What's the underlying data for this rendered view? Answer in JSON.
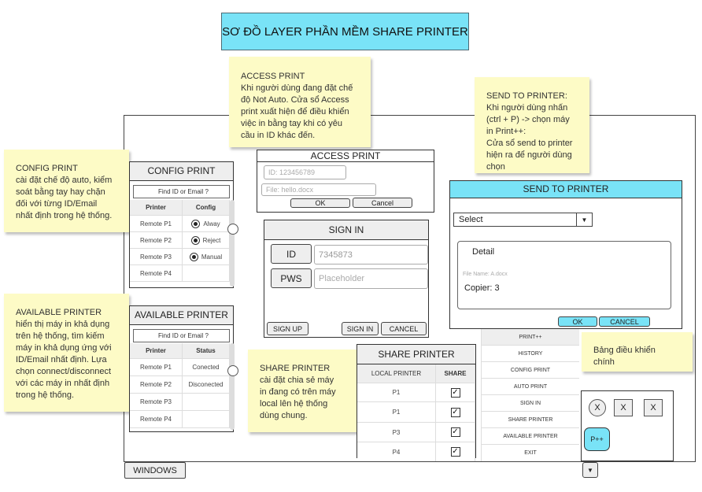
{
  "title": "SƠ ĐỒ LAYER PHẦN MỀM SHARE PRINTER",
  "notes": {
    "access": {
      "title": "ACCESS PRINT",
      "body": "Khi người dùng đang đặt chế\nđộ Not Auto. Cửa sổ Access\nprint xuất hiện để điều khiển\nviệc in bằng tay khi có yêu\ncầu in ID khác đến."
    },
    "send": {
      "title": "SEND TO PRINTER:",
      "body": "Khi người dùng nhấn\n(ctrl + P) -> chọn máy\nin Print++:\nCửa sổ send to printer\nhiện ra để người dùng\nchọn"
    },
    "config": {
      "title": "CONFIG PRINT",
      "body": "cài đặt chế độ auto, kiểm\nsoát bằng tay hay chặn\nđối với từng ID/Email\nnhất định trong hệ thống."
    },
    "available": {
      "title": "AVAILABLE PRINTER",
      "body": "hiển thị máy in khả dụng\ntrên hệ thống, tìm kiếm\nmáy in khả dụng ứng với\nID/Email nhất định. Lựa\nchọn connect/disconnect\nvới các máy in nhất định\ntrong hệ thống."
    },
    "share": {
      "title": "SHARE PRINTER",
      "body": "cài đặt chia sẻ máy\nin đang có trên máy\nlocal lên hệ thống\ndùng chung."
    },
    "dashboard": {
      "title": "Bảng điều khiển\nchính"
    }
  },
  "config_print": {
    "title": "CONFIG PRINT",
    "search_placeholder": "Find ID or Email ?",
    "headers": [
      "Printer",
      "Config"
    ],
    "rows": [
      {
        "printer": "Remote P1",
        "config": "Alway",
        "radio": true
      },
      {
        "printer": "Remote P2",
        "config": "Reject",
        "radio": true
      },
      {
        "printer": "Remote P3",
        "config": "Manual",
        "radio": true
      },
      {
        "printer": "Remote P4",
        "config": "",
        "radio": false
      }
    ]
  },
  "available_printer": {
    "title": "AVAILABLE PRINTER",
    "search_placeholder": "Find ID or Email ?",
    "headers": [
      "Printer",
      "Status"
    ],
    "rows": [
      {
        "printer": "Remote P1",
        "status": "Conected"
      },
      {
        "printer": "Remote P2",
        "status": "Disconected"
      },
      {
        "printer": "Remote P3",
        "status": ""
      },
      {
        "printer": "Remote P4",
        "status": ""
      }
    ]
  },
  "access_print": {
    "title": "ACCESS PRINT",
    "id_placeholder": "ID: 123456789",
    "file_placeholder": "File: hello.docx",
    "ok": "OK",
    "cancel": "Cancel"
  },
  "sign_in": {
    "title": "SIGN IN",
    "id_label": "ID",
    "id_value": "7345873",
    "pws_label": "PWS",
    "pws_placeholder": "Placeholder",
    "signup": "SIGN UP",
    "signin": "SIGN IN",
    "cancel": "CANCEL"
  },
  "send_to_printer": {
    "title": "SEND TO PRINTER",
    "select": "Select",
    "detail": "Detail",
    "file_name": "File Name: A.docx",
    "copies": "Copier: 3",
    "ok": "OK",
    "cancel": "CANCEL",
    "accent": "#79e3f7"
  },
  "share_printer": {
    "title": "SHARE PRINTER",
    "headers": [
      "LOCAL PRINTER",
      "SHARE"
    ],
    "rows": [
      {
        "printer": "P1",
        "share": true
      },
      {
        "printer": "P1",
        "share": true
      },
      {
        "printer": "P3",
        "share": true
      },
      {
        "printer": "P4",
        "share": true
      }
    ]
  },
  "menu": {
    "items": [
      "PRINT++",
      "HISTORY",
      "CONFIG PRINT",
      "AUTO PRINT",
      "SIGN IN",
      "SHARE PRINTER",
      "AVAILABLE PRINTER",
      "EXIT"
    ]
  },
  "tray": {
    "buttons": [
      "X",
      "X",
      "X"
    ],
    "app_label": "P++"
  },
  "taskbar": {
    "windows_label": "WINDOWS",
    "arrow_icon": "chevron-down-icon"
  }
}
